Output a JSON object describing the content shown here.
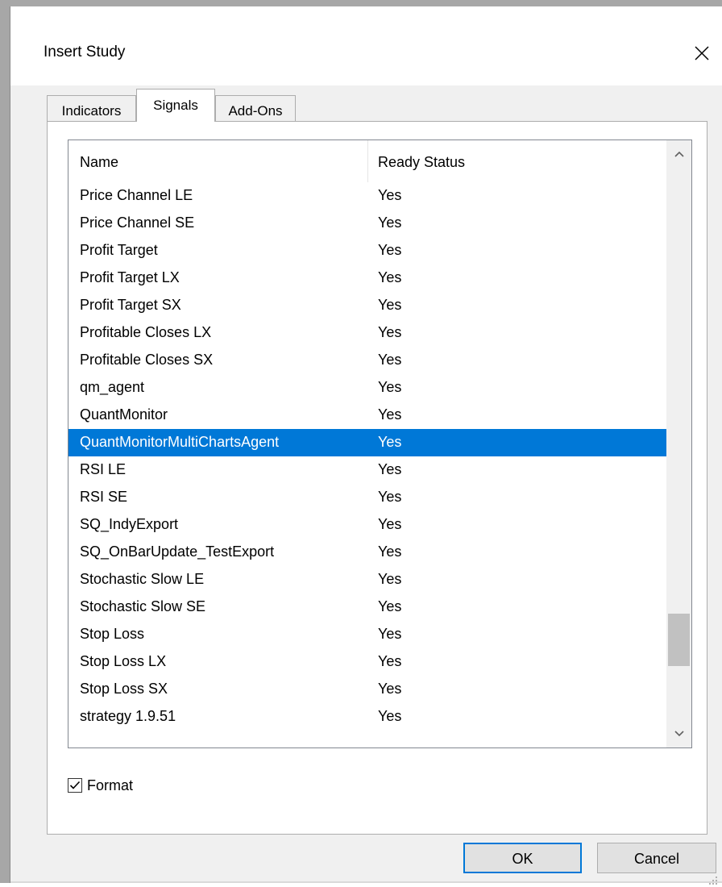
{
  "dialog": {
    "title": "Insert Study"
  },
  "tabs": [
    {
      "label": "Indicators",
      "selected": false
    },
    {
      "label": "Signals",
      "selected": true
    },
    {
      "label": "Add-Ons",
      "selected": false
    }
  ],
  "list": {
    "columns": [
      "Name",
      "Ready Status"
    ],
    "selected_index": 9,
    "rows": [
      {
        "name": "Price Channel LE",
        "status": "Yes"
      },
      {
        "name": "Price Channel SE",
        "status": "Yes"
      },
      {
        "name": "Profit Target",
        "status": "Yes"
      },
      {
        "name": "Profit Target LX",
        "status": "Yes"
      },
      {
        "name": "Profit Target SX",
        "status": "Yes"
      },
      {
        "name": "Profitable Closes LX",
        "status": "Yes"
      },
      {
        "name": "Profitable Closes SX",
        "status": "Yes"
      },
      {
        "name": "qm_agent",
        "status": "Yes"
      },
      {
        "name": "QuantMonitor",
        "status": "Yes"
      },
      {
        "name": "QuantMonitorMultiChartsAgent",
        "status": "Yes"
      },
      {
        "name": "RSI LE",
        "status": "Yes"
      },
      {
        "name": "RSI SE",
        "status": "Yes"
      },
      {
        "name": "SQ_IndyExport",
        "status": "Yes"
      },
      {
        "name": "SQ_OnBarUpdate_TestExport",
        "status": "Yes"
      },
      {
        "name": "Stochastic Slow LE",
        "status": "Yes"
      },
      {
        "name": "Stochastic Slow SE",
        "status": "Yes"
      },
      {
        "name": "Stop Loss",
        "status": "Yes"
      },
      {
        "name": "Stop Loss LX",
        "status": "Yes"
      },
      {
        "name": "Stop Loss SX",
        "status": "Yes"
      },
      {
        "name": "strategy 1.9.51",
        "status": "Yes"
      }
    ]
  },
  "format_checkbox": {
    "label": "Format",
    "checked": true
  },
  "buttons": {
    "ok": "OK",
    "cancel": "Cancel"
  },
  "colors": {
    "selection": "#0078d7",
    "dialog_bg": "#f0f0f0"
  }
}
